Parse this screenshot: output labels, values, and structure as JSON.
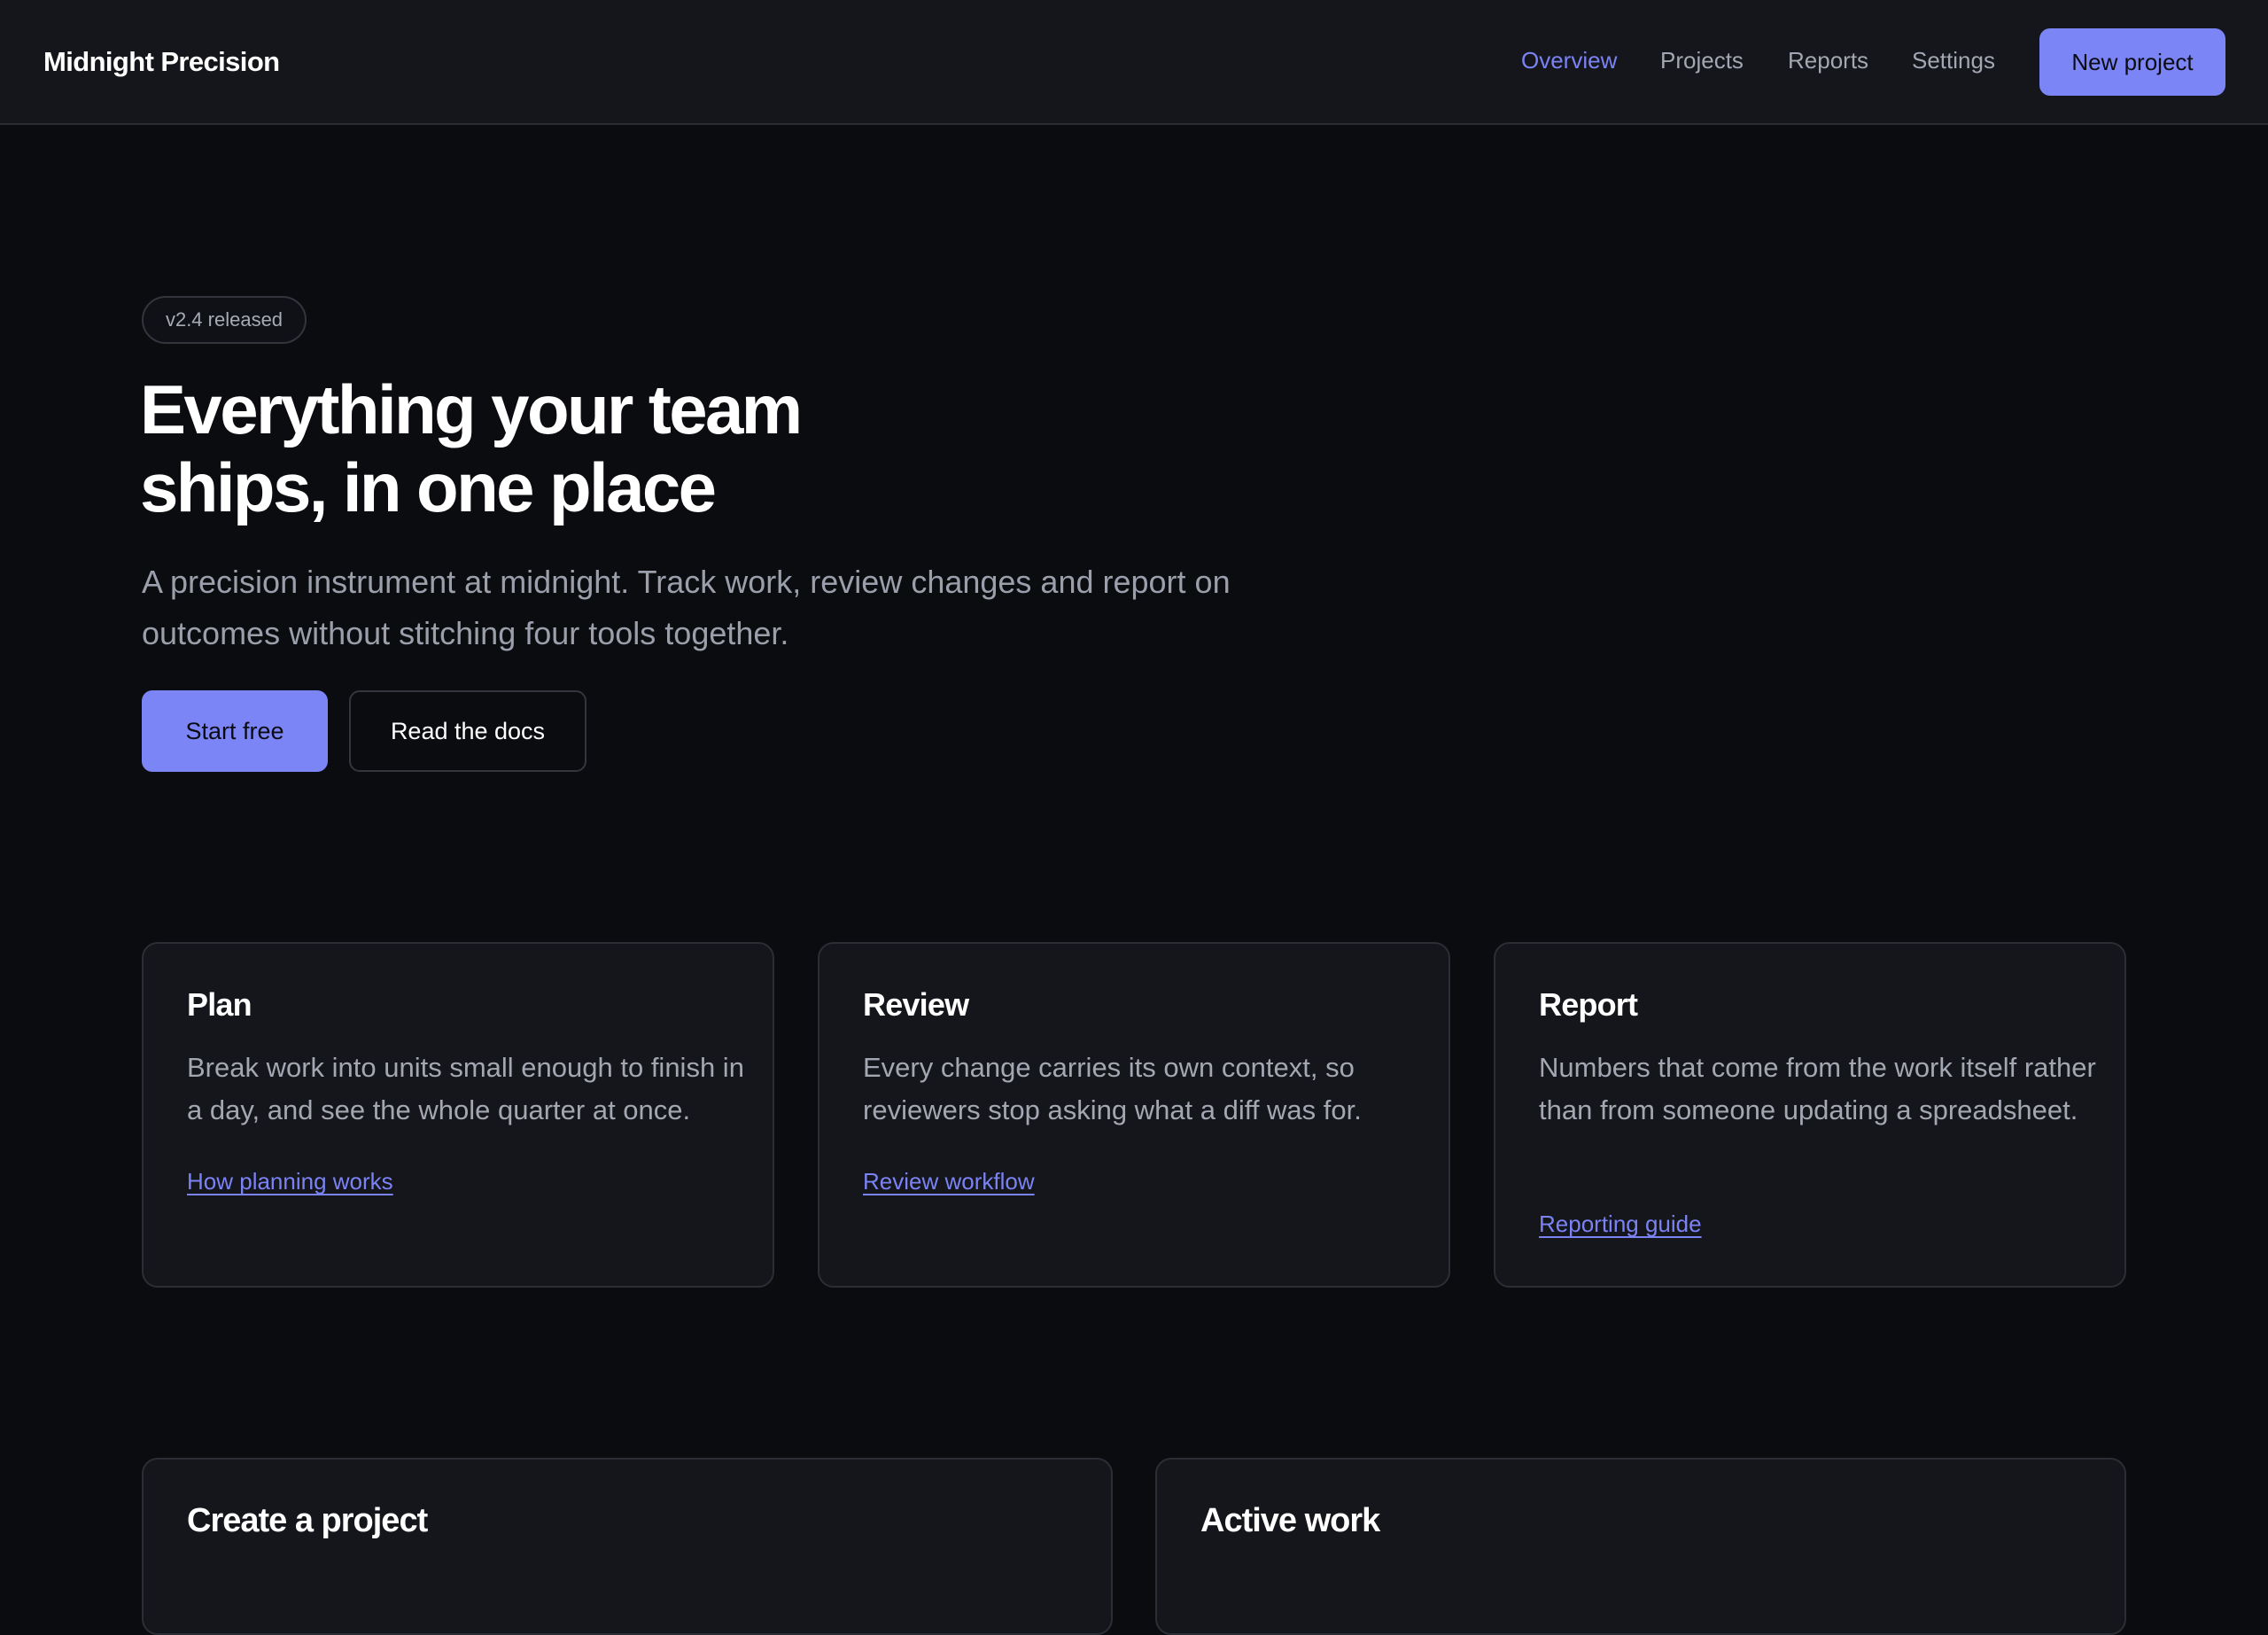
{
  "header": {
    "brand": "Midnight Precision",
    "nav": [
      {
        "label": "Overview",
        "active": true
      },
      {
        "label": "Projects",
        "active": false
      },
      {
        "label": "Reports",
        "active": false
      },
      {
        "label": "Settings",
        "active": false
      }
    ],
    "cta_label": "New project"
  },
  "hero": {
    "badge": "v2.4 released",
    "title_line1": "Everything your team",
    "title_line2": "ships, in one place",
    "subtitle_line1": "A precision instrument at midnight. Track work, review changes and report on",
    "subtitle_line2": "outcomes without stitching four tools together.",
    "primary_label": "Start free",
    "secondary_label": "Read the docs"
  },
  "features": [
    {
      "title": "Plan",
      "body": "Break work into units small enough to finish in a day, and see the whole quarter at once.",
      "link": "How planning works"
    },
    {
      "title": "Review",
      "body": "Every change carries its own context, so reviewers stop asking what a diff was for.",
      "link": "Review workflow"
    },
    {
      "title": "Report",
      "body": "Numbers that come from the work itself rather than from someone updating a spreadsheet.",
      "link": "Reporting guide"
    }
  ],
  "panels": [
    {
      "title": "Create a project"
    },
    {
      "title": "Active work"
    }
  ],
  "colors": {
    "accent": "#7c85f6",
    "background": "#0b0c0f",
    "surface": "#15161b",
    "border": "#2c2e35"
  }
}
